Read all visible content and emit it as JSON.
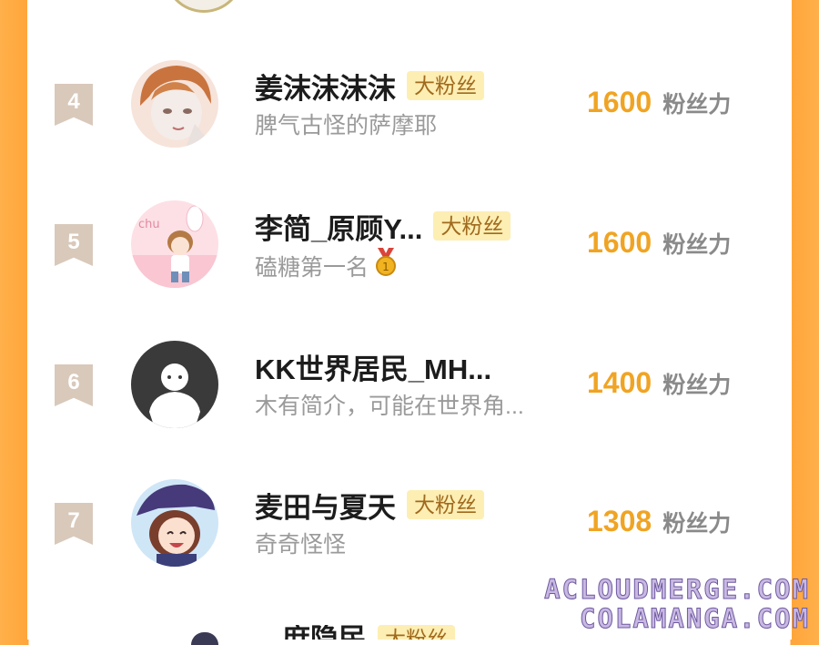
{
  "rows": [
    {
      "rank": "4",
      "name": "姜沫沫沫沫",
      "badge": "大粉丝",
      "bio": "脾气古怪的萨摩耶",
      "score": "1600",
      "unit": "粉丝力"
    },
    {
      "rank": "5",
      "name": "李简_原顾Y...",
      "badge": "大粉丝",
      "bio": "磕糖第一名",
      "score": "1600",
      "unit": "粉丝力",
      "bio_icon": "gold-medal-icon"
    },
    {
      "rank": "6",
      "name": "KK世界居民_MH...",
      "badge": "",
      "bio": "木有简介，可能在世界角...",
      "score": "1400",
      "unit": "粉丝力"
    },
    {
      "rank": "7",
      "name": "麦田与夏天",
      "badge": "大粉丝",
      "bio": "奇奇怪怪",
      "score": "1308",
      "unit": "粉丝力"
    }
  ],
  "partial_row": {
    "name": "庶隐民",
    "badge": "大粉丝"
  },
  "watermark": {
    "line1": "ACLOUDMERGE.COM",
    "line2": "COLAMANGA.COM"
  },
  "colors": {
    "accent": "#f0a424",
    "badge_bg": "#fdeeb3",
    "rank_bg": "#d9c9bb",
    "side_orange": "#ffa53a"
  }
}
